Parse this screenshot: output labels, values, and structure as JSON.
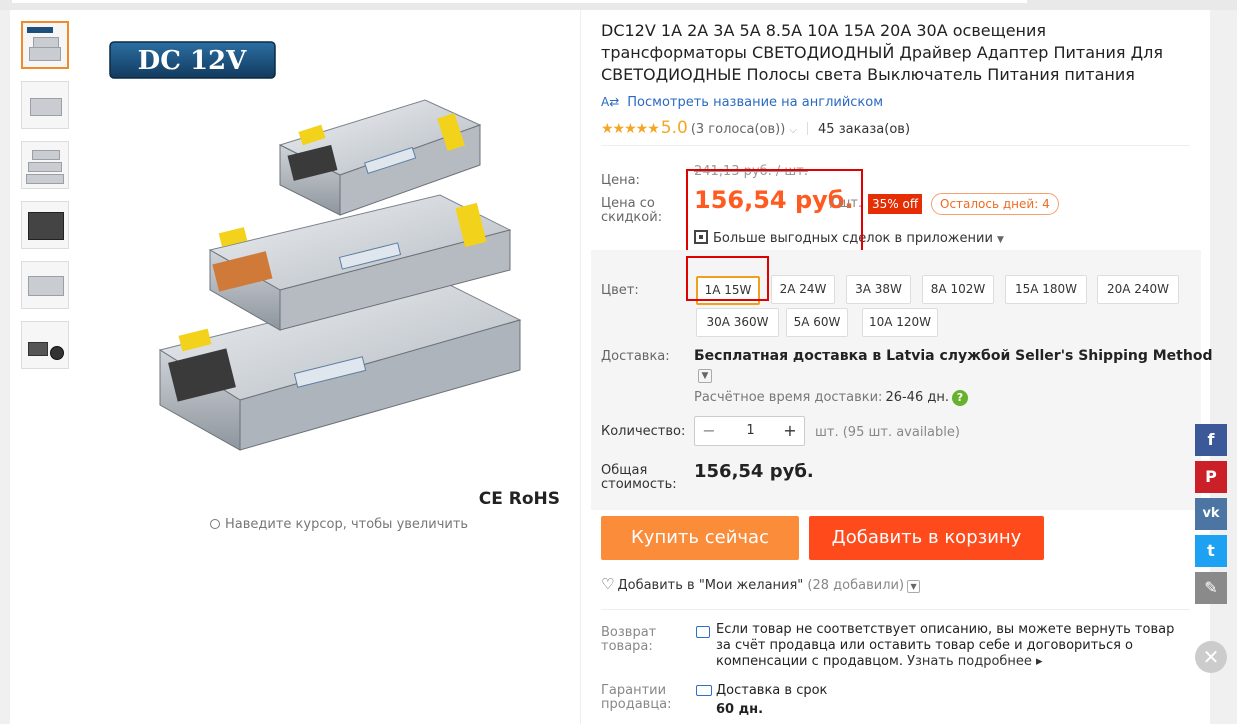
{
  "gallery": {
    "thumbnails": [
      "thumb-1",
      "thumb-2",
      "thumb-3",
      "thumb-4",
      "thumb-5",
      "thumb-6"
    ],
    "main_label": "DC 12V",
    "cert_mark": "CE RoHS",
    "zoom_hint": "Наведите курсор, чтобы увеличить"
  },
  "product": {
    "title": "DC12V 1A 2A 3A 5A 8.5A 10A 15A 20A 30A освещения трансформаторы СВЕТОДИОДНЫЙ Драйвер Адаптер Питания Для СВЕТОДИОДНЫЕ Полосы света Выключатель Питания питания",
    "translate_icon": "A⇄",
    "translate_link": "Посмотреть название на английском",
    "stars": "★★★★★",
    "rating_score": "5.0",
    "votes": "(3 голоса(ов))",
    "orders": "45 заказа(ов)"
  },
  "price": {
    "price_label": "Цена:",
    "old_price": "241,13 руб. / шт.",
    "discount_label": "Цена со скидкой:",
    "new_price": "156,54 руб.",
    "unit": "/ шт.",
    "discount_badge": "35% off",
    "days_left": "Осталось дней: 4",
    "app_deals": "Больше выгодных сделок в приложении"
  },
  "sku": {
    "label": "Цвет:",
    "selected": "1A 15W",
    "options": [
      "1A 15W",
      "2A 24W",
      "3A 38W",
      "8A 102W",
      "15A 180W",
      "20A 240W",
      "30A 360W",
      "5A 60W",
      "10A 120W"
    ]
  },
  "shipping": {
    "label": "Доставка:",
    "text": "Бесплатная доставка в Latvia службой Seller's Shipping Method",
    "eta_label": "Расчётное время доставки:",
    "eta_value": "26-46 дн.",
    "help": "?"
  },
  "quantity": {
    "label": "Количество:",
    "minus": "−",
    "value": "1",
    "plus": "+",
    "available": "шт. (95 шт. available)"
  },
  "total": {
    "label": "Общая стоимость:",
    "value": "156,54 руб."
  },
  "actions": {
    "buy_now": "Купить сейчас",
    "add_to_cart": "Добавить в корзину",
    "wishlist": "Добавить в \"Мои желания\"",
    "wishlist_count": "(28 добавили)"
  },
  "returns": {
    "label": "Возврат товара:",
    "text": "Если товар не соответствует описанию, вы можете вернуть товар за счёт продавца или оставить товар себе и договориться о компенсации с продавцом.",
    "more": "Узнать подробнее ▸"
  },
  "guarantee": {
    "label": "Гарантии продавца:",
    "text": "Доставка в срок",
    "days": "60 дн."
  },
  "social": {
    "facebook": "f",
    "pinterest": "P",
    "vk": "vk",
    "twitter": "t",
    "edit": "✎",
    "close": "✕",
    "colors": {
      "facebook": "#3b5998",
      "pinterest": "#cb2027",
      "vk": "#4c75a3",
      "twitter": "#1da1f2",
      "edit": "#8a8a8a"
    }
  },
  "colors": {
    "accent": "#ff5a1f",
    "buy": "#fa8c3a",
    "cart": "#ff4b1c",
    "link": "#2969c2",
    "star": "#f5a623"
  }
}
